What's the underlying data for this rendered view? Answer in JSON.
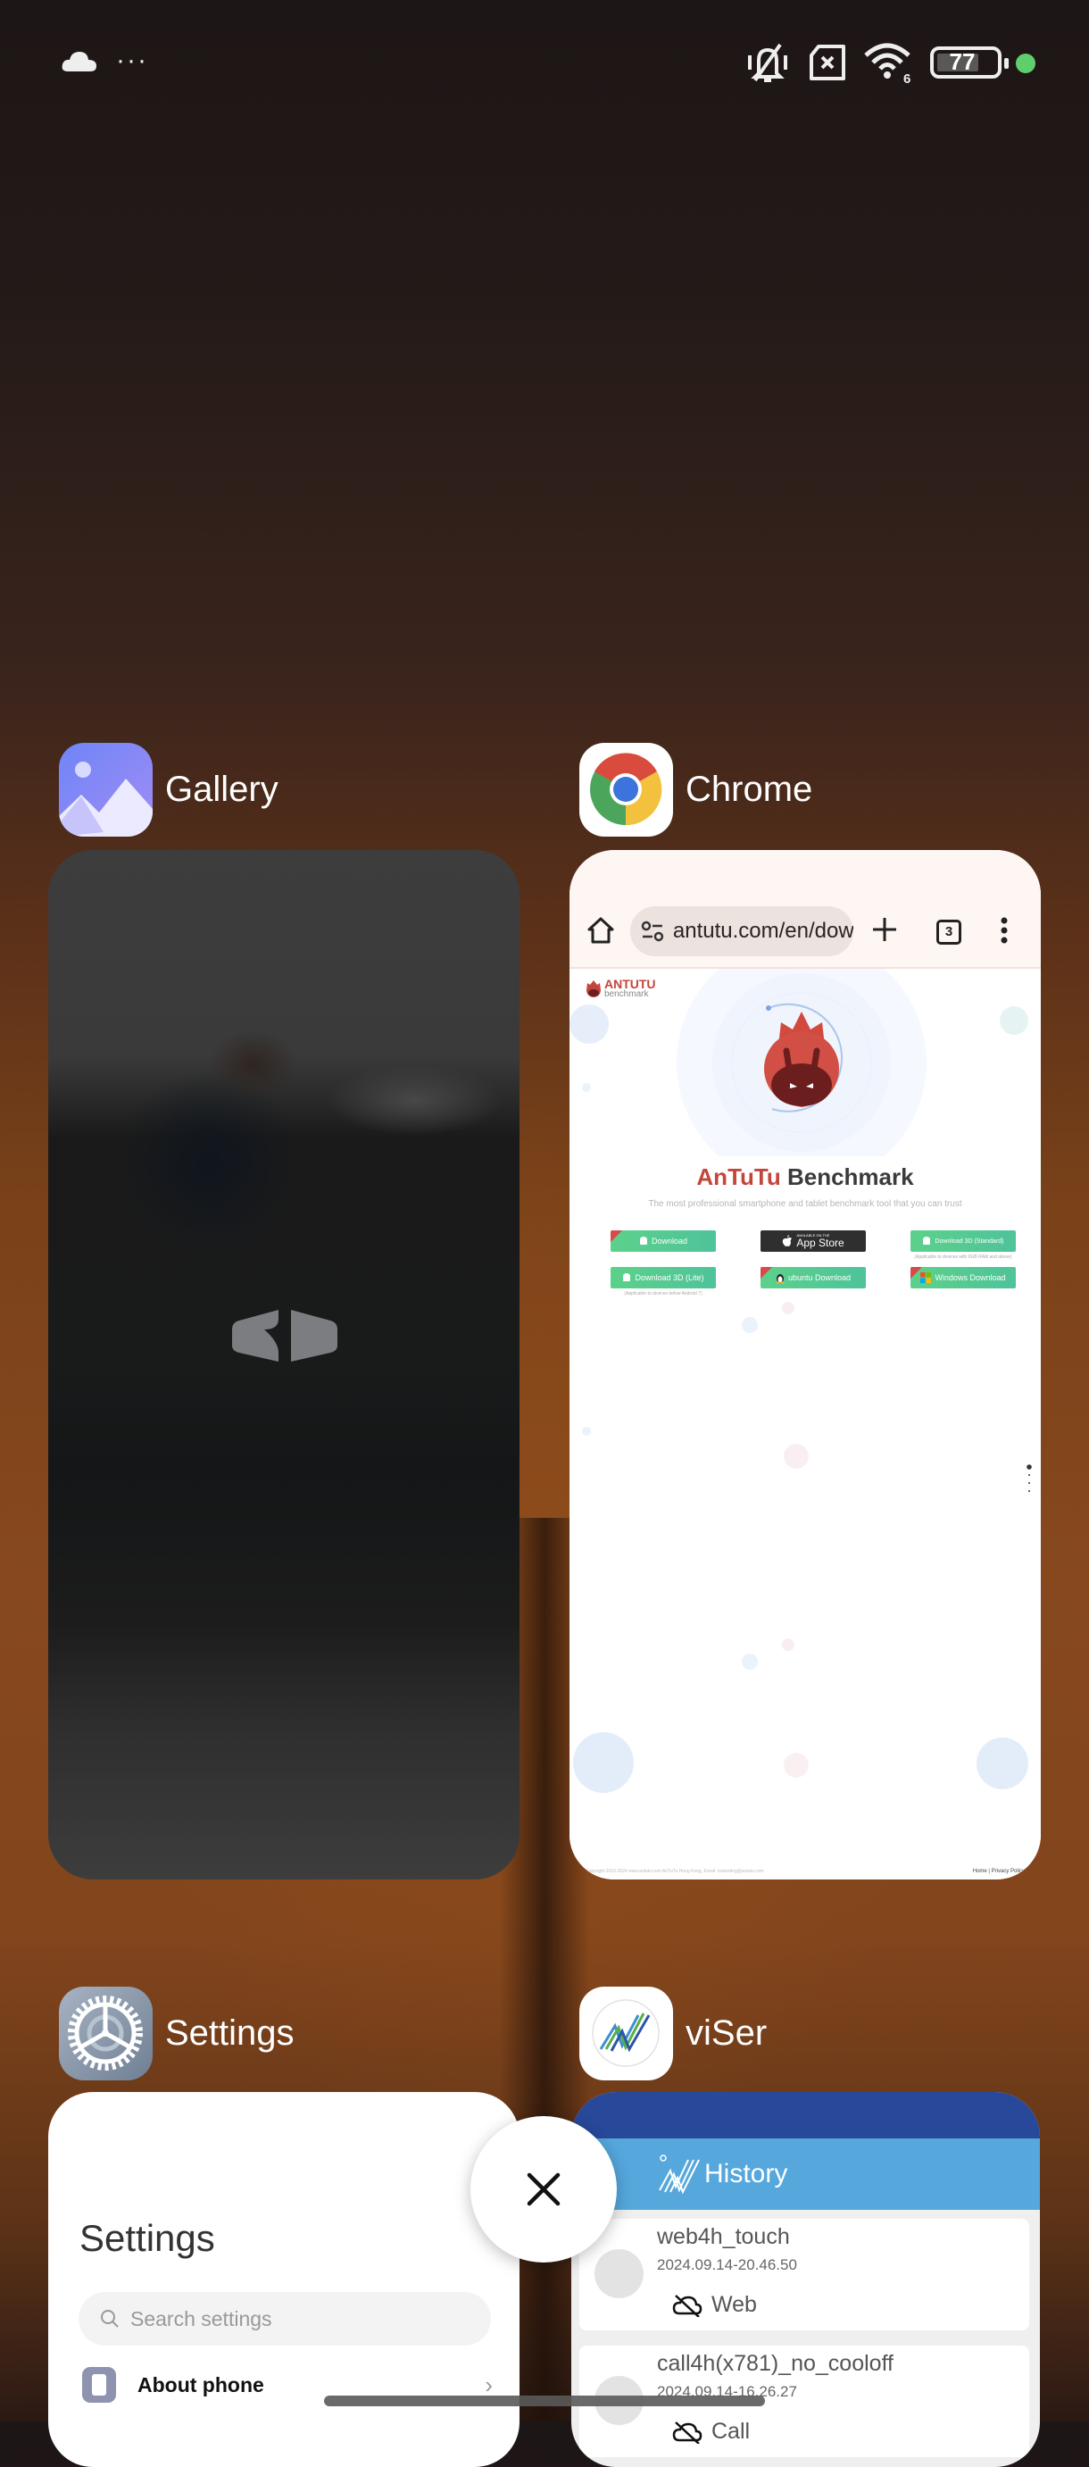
{
  "status_bar": {
    "left_icons": [
      "cloud-icon",
      "more-notifications-icon"
    ],
    "overflow_dots": "···",
    "right_icons": [
      "mute-vibrate-icon",
      "no-sim-icon",
      "wifi-icon",
      "battery-icon",
      "active-indicator-dot"
    ],
    "wifi_label": "6",
    "battery_level": "77",
    "indicator_color": "#5fcf6d"
  },
  "recents": [
    {
      "app": "Gallery",
      "icon": "gallery-icon"
    },
    {
      "app": "Chrome",
      "icon": "chrome-icon"
    },
    {
      "app": "Settings",
      "icon": "settings-gear-icon"
    },
    {
      "app": "viSer",
      "icon": "viser-icon"
    }
  ],
  "chrome": {
    "url": "antutu.com/en/dow",
    "tab_count": "3",
    "page": {
      "logo_title": "ANTUTU",
      "logo_subtitle": "benchmark",
      "title_red": "AnTuTu",
      "title_dark": " Benchmark",
      "subtitle": "The most professional smartphone and tablet benchmark tool that you can trust",
      "buttons": [
        {
          "label": "Download",
          "ribbon": "V10",
          "style": "green",
          "icon": "android-icon"
        },
        {
          "label": "App Store",
          "pre": "AVAILABLE ON THE",
          "style": "dark",
          "icon": "apple-icon"
        },
        {
          "label": "Download 3D (Standard)",
          "style": "green",
          "icon": "android-icon",
          "note": "(Applicable to devices with 6GB RAM and above)"
        },
        {
          "label": "Download 3D (Lite)",
          "style": "green",
          "icon": "android-icon",
          "note": "(Applicable to devices below Android 7)"
        },
        {
          "label": "ubuntu Download",
          "ribbon": "V1",
          "style": "green",
          "icon": "linux-icon"
        },
        {
          "label": "Windows Download",
          "ribbon": "V1",
          "style": "green",
          "icon": "windows-icon"
        }
      ],
      "footer_left": "Copyright 2010-2024 www.antutu.com AnTuTu Hong Kong, Email: marketing@antutu.com",
      "footer_right": "Home | Privacy Policy"
    }
  },
  "settings": {
    "title": "Settings",
    "search_placeholder": "Search settings",
    "rows": [
      {
        "label": "About phone",
        "chevron": "›"
      }
    ]
  },
  "viser": {
    "header": "History",
    "history": [
      {
        "name": "web4h_touch",
        "date": "2024.09.14-20.46.50",
        "type": "Web"
      },
      {
        "name": "call4h(x781)_no_cooloff",
        "date": "2024.09.14-16.26.27",
        "type": "Call"
      }
    ]
  },
  "colors": {
    "viser_dark": "#28489a",
    "viser_bar": "#55a7dc",
    "antutu_red": "#c4453b",
    "download_green": "#5cd18a"
  }
}
